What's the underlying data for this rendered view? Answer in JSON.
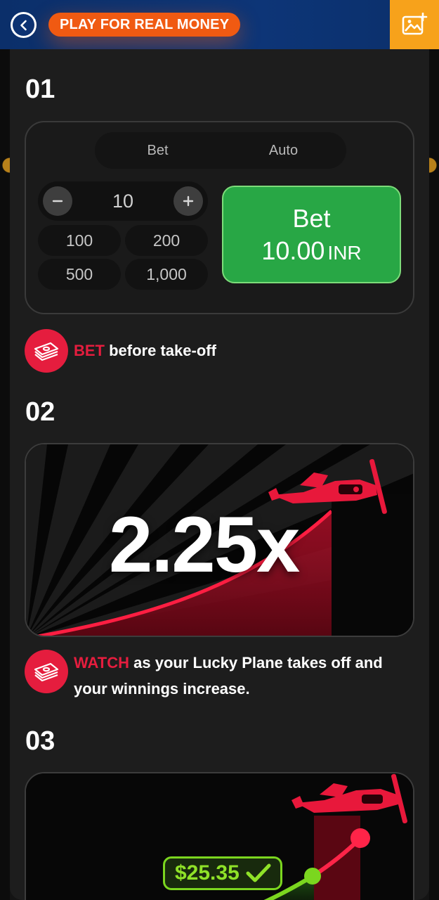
{
  "header": {
    "back_icon": "back-arrow-icon",
    "real_money_label": "PLAY FOR REAL MONEY",
    "gallery_icon": "image-add-icon"
  },
  "steps": [
    {
      "number": "01",
      "tabs": [
        {
          "label": "Bet",
          "active": true
        },
        {
          "label": "Auto",
          "active": false
        }
      ],
      "stepper_value": "10",
      "quick_amounts": [
        "100",
        "200",
        "500",
        "1,000"
      ],
      "bet_button": {
        "line1": "Bet",
        "amount": "10.00",
        "currency": "INR"
      },
      "caption_highlight": "BET",
      "caption_rest": " before take-off"
    },
    {
      "number": "02",
      "multiplier": "2.25x",
      "caption_highlight": "WATCH",
      "caption_rest": " as your Lucky Plane takes off and your winnings increase."
    },
    {
      "number": "03",
      "win_amount": "$25.35"
    }
  ],
  "colors": {
    "header_bg": "#0c3272",
    "accent_orange": "#f05a12",
    "gallery_bg": "#f7a21b",
    "bet_green": "#28a745",
    "brand_red": "#e51d3e",
    "win_green": "#8fe228"
  }
}
